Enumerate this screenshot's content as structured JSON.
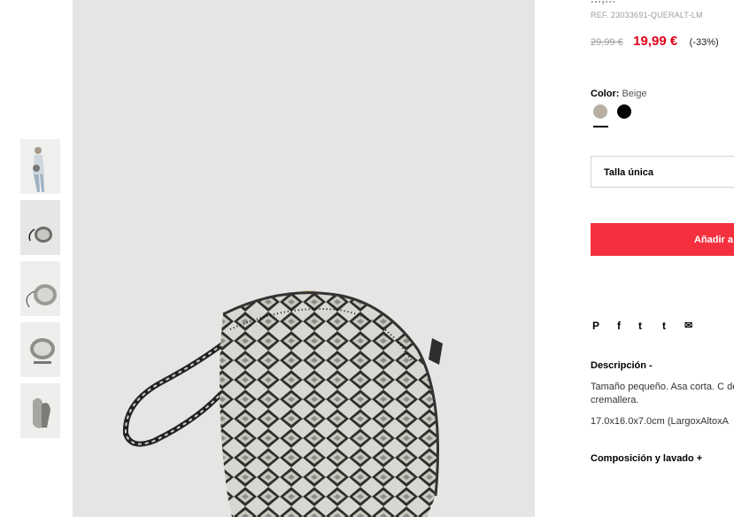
{
  "product": {
    "title_fragment": "...,...",
    "reference": "REF. 23033691-QUERALT-LM",
    "old_price": "29,99 €",
    "new_price": "19,99 €",
    "discount": "(-33%)"
  },
  "color": {
    "label": "Color:",
    "value": "Beige",
    "swatches": [
      {
        "name": "Beige",
        "hex": "#b7b0a2"
      },
      {
        "name": "Negro",
        "hex": "#000000"
      }
    ]
  },
  "size": {
    "selected": "Talla única"
  },
  "cart": {
    "add_label": "Añadir a"
  },
  "share": {
    "pinterest": "P",
    "facebook": "f",
    "twitter": "t",
    "tumblr": "t",
    "email": "✉"
  },
  "description": {
    "heading": "Descripción -",
    "text": "Tamaño pequeño. Asa corta. C de cremallera.",
    "dimensions": "17.0x16.0x7.0cm (LargoxAltoxA"
  },
  "composition": {
    "heading": "Composición y lavado +"
  },
  "icons": [
    "pinterest-icon",
    "facebook-icon",
    "twitter-icon",
    "tumblr-icon",
    "email-icon"
  ],
  "colors": {
    "accent": "#f4303f",
    "price_red": "#e2001a"
  }
}
